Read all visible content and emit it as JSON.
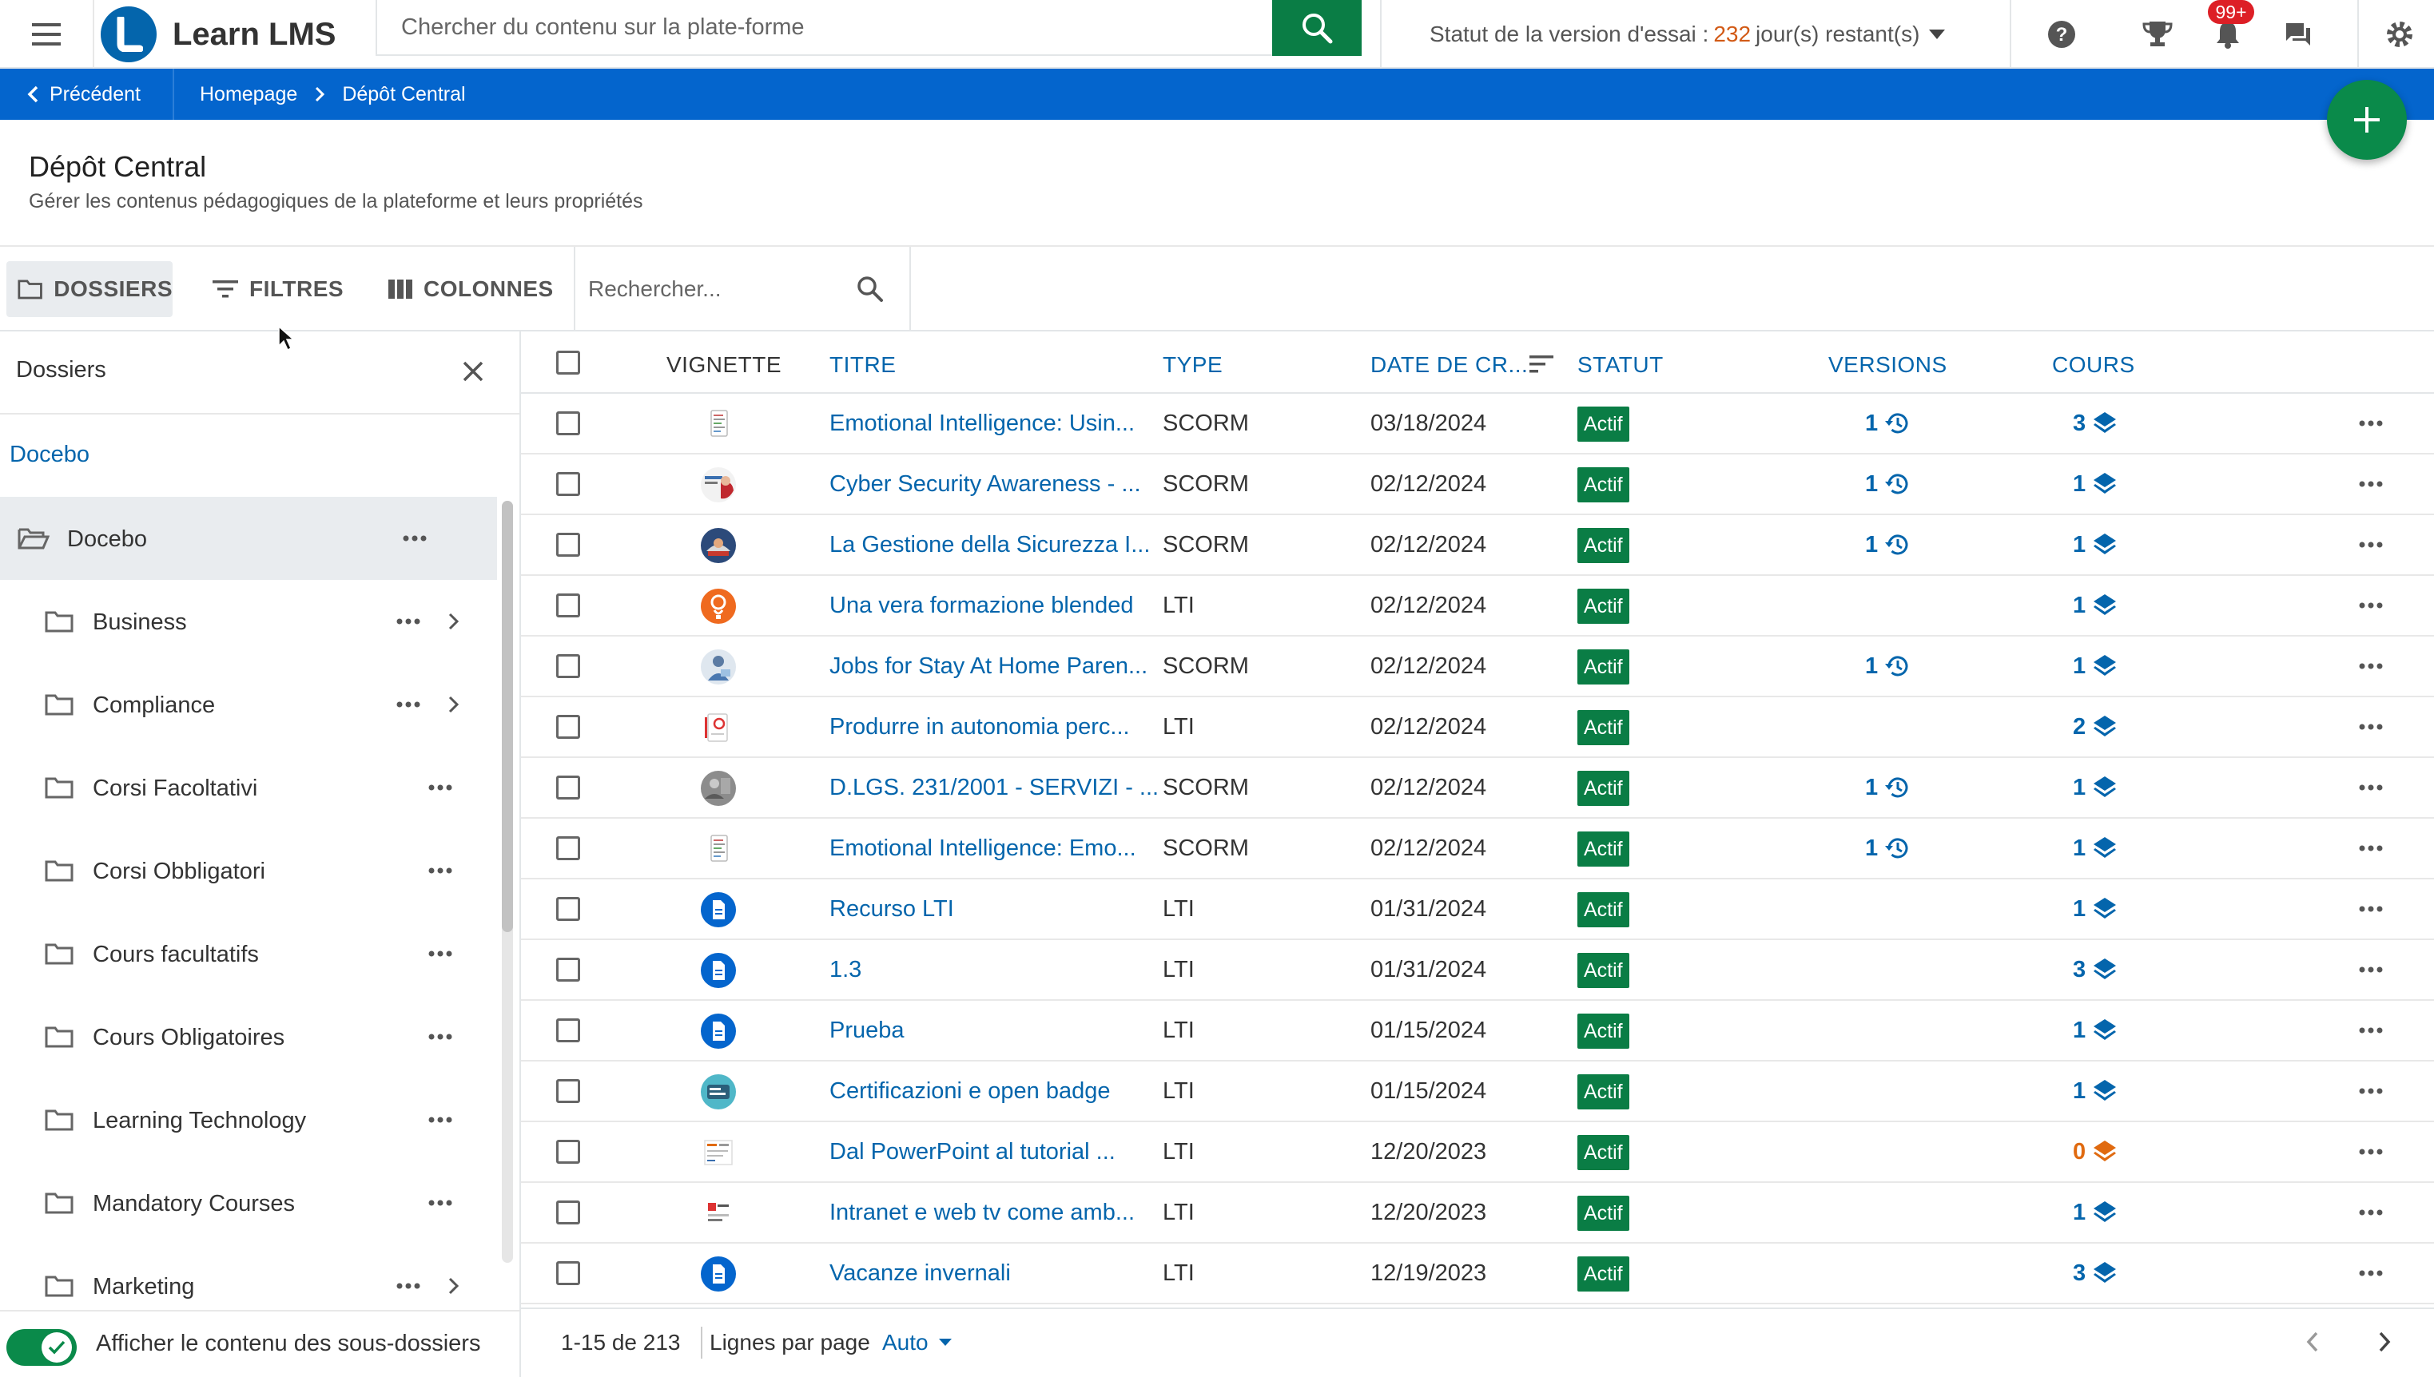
{
  "app": {
    "logo_text": "Learn LMS",
    "search_placeholder": "Chercher du contenu sur la plate-forme",
    "trial_prefix": "Statut de la version d'essai :",
    "trial_days": "232",
    "trial_suffix": "jour(s) restant(s)",
    "notifications_badge": "99+"
  },
  "breadcrumb": {
    "back_label": "Précédent",
    "items": [
      "Homepage",
      "Dépôt Central"
    ]
  },
  "page": {
    "title": "Dépôt Central",
    "subtitle": "Gérer les contenus pédagogiques de la plateforme et leurs propriétés"
  },
  "toolbar": {
    "folders_label": "DOSSIERS",
    "filters_label": "FILTRES",
    "columns_label": "COLONNES",
    "search_placeholder": "Rechercher..."
  },
  "sidebar": {
    "title": "Dossiers",
    "root_link": "Docebo",
    "folders": [
      {
        "name": "Docebo",
        "selected": true,
        "open": true,
        "has_children": false
      },
      {
        "name": "Business",
        "has_children": true
      },
      {
        "name": "Compliance",
        "has_children": true
      },
      {
        "name": "Corsi Facoltativi",
        "has_children": false
      },
      {
        "name": "Corsi Obbligatori",
        "has_children": false
      },
      {
        "name": "Cours facultatifs",
        "has_children": false
      },
      {
        "name": "Cours Obligatoires",
        "has_children": false
      },
      {
        "name": "Learning Technology",
        "has_children": false
      },
      {
        "name": "Mandatory Courses",
        "has_children": false
      },
      {
        "name": "Marketing",
        "has_children": true
      }
    ],
    "subfolder_toggle_label": "Afficher le contenu des sous-dossiers",
    "subfolder_toggle_on": true
  },
  "table": {
    "columns": {
      "thumbnail": "VIGNETTE",
      "title": "TITRE",
      "type": "TYPE",
      "date": "DATE DE CR...",
      "status": "STATUT",
      "versions": "VERSIONS",
      "courses": "COURS"
    },
    "rows": [
      {
        "thumb": "doc",
        "title": "Emotional Intelligence: Usin...",
        "type": "SCORM",
        "date": "03/18/2024",
        "status": "Actif",
        "versions": "1",
        "courses": "3"
      },
      {
        "thumb": "cyber",
        "title": "Cyber Security Awareness - ...",
        "type": "SCORM",
        "date": "02/12/2024",
        "status": "Actif",
        "versions": "1",
        "courses": "1"
      },
      {
        "thumb": "safety",
        "title": "La Gestione della Sicurezza I...",
        "type": "SCORM",
        "date": "02/12/2024",
        "status": "Actif",
        "versions": "1",
        "courses": "1"
      },
      {
        "thumb": "orange",
        "title": "Una vera formazione blended",
        "type": "LTI",
        "date": "02/12/2024",
        "status": "Actif",
        "versions": "",
        "courses": "1"
      },
      {
        "thumb": "person",
        "title": "Jobs for Stay At Home Paren...",
        "type": "SCORM",
        "date": "02/12/2024",
        "status": "Actif",
        "versions": "1",
        "courses": "1"
      },
      {
        "thumb": "doc-red",
        "title": "Produrre in autonomia perc...",
        "type": "LTI",
        "date": "02/12/2024",
        "status": "Actif",
        "versions": "",
        "courses": "2"
      },
      {
        "thumb": "photo",
        "title": "D.LGS. 231/2001 - SERVIZI - ...",
        "type": "SCORM",
        "date": "02/12/2024",
        "status": "Actif",
        "versions": "1",
        "courses": "1"
      },
      {
        "thumb": "doc",
        "title": "Emotional Intelligence: Emo...",
        "type": "SCORM",
        "date": "02/12/2024",
        "status": "Actif",
        "versions": "1",
        "courses": "1"
      },
      {
        "thumb": "file-blue",
        "title": "Recurso LTI",
        "type": "LTI",
        "date": "01/31/2024",
        "status": "Actif",
        "versions": "",
        "courses": "1"
      },
      {
        "thumb": "file-blue",
        "title": "1.3",
        "type": "LTI",
        "date": "01/31/2024",
        "status": "Actif",
        "versions": "",
        "courses": "3"
      },
      {
        "thumb": "file-blue",
        "title": "Prueba",
        "type": "LTI",
        "date": "01/15/2024",
        "status": "Actif",
        "versions": "",
        "courses": "1"
      },
      {
        "thumb": "badge",
        "title": "Certificazioni e open badge",
        "type": "LTI",
        "date": "01/15/2024",
        "status": "Actif",
        "versions": "",
        "courses": "1"
      },
      {
        "thumb": "slides",
        "title": "Dal PowerPoint al tutorial ...",
        "type": "LTI",
        "date": "12/20/2023",
        "status": "Actif",
        "versions": "",
        "courses": "0",
        "courses_warning": true
      },
      {
        "thumb": "intranet",
        "title": "Intranet e web tv come amb...",
        "type": "LTI",
        "date": "12/20/2023",
        "status": "Actif",
        "versions": "",
        "courses": "1"
      },
      {
        "thumb": "file-blue",
        "title": "Vacanze invernali",
        "type": "LTI",
        "date": "12/19/2023",
        "status": "Actif",
        "versions": "",
        "courses": "3"
      }
    ]
  },
  "pagination": {
    "range": "1-15 de 213",
    "rows_per_page_label": "Lignes par page",
    "rows_per_page_value": "Auto"
  },
  "colors": {
    "primary": "#0465cd",
    "link": "#0465ac",
    "success": "#0a7d45",
    "warning": "#e06a10",
    "badge": "#dd1f26"
  }
}
